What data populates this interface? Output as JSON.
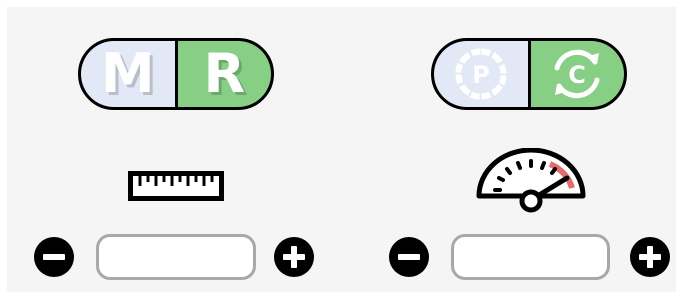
{
  "left_control": {
    "mode_toggle": {
      "option_a": "M",
      "option_b": "R",
      "option_a_color": "#e3e8f7",
      "option_b_color": "#86cf84"
    },
    "indicator_icon": "ruler-icon",
    "value_field": {
      "value": "",
      "placeholder": ""
    },
    "decrement_icon": "minus-circle-icon",
    "increment_icon": "plus-circle-icon"
  },
  "right_control": {
    "mode_toggle": {
      "option_a_icon": "pause-circle-icon",
      "option_b_icon": "refresh-circle-icon",
      "option_a_color": "#e3e8f7",
      "option_b_color": "#86cf84"
    },
    "indicator_icon": "speedometer-icon",
    "value_field": {
      "value": "",
      "placeholder": ""
    },
    "decrement_icon": "minus-circle-icon",
    "increment_icon": "plus-circle-icon"
  },
  "colors": {
    "background": "#f5f5f5",
    "field_border": "#a8a8a8",
    "gauge_redline": "#e86a6a"
  }
}
